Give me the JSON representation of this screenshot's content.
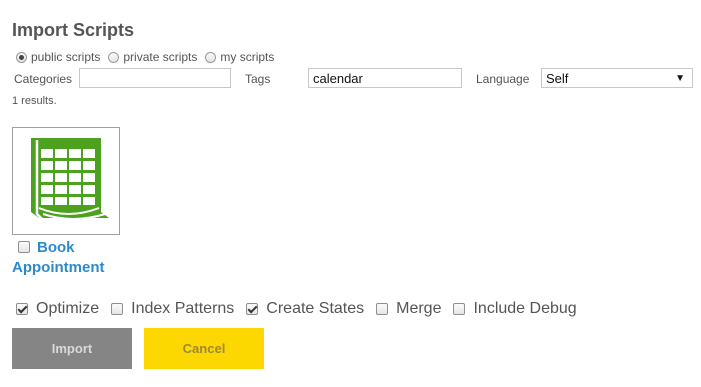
{
  "title": "Import Scripts",
  "scope": {
    "options": [
      {
        "label": "public scripts",
        "checked": true
      },
      {
        "label": "private scripts",
        "checked": false
      },
      {
        "label": "my scripts",
        "checked": false
      }
    ]
  },
  "filters": {
    "categories_label": "Categories",
    "categories_value": "",
    "tags_label": "Tags",
    "tags_value": "calendar",
    "language_label": "Language",
    "language_value": "Self",
    "language_caret": "▼"
  },
  "results_text": "1 results.",
  "results": [
    {
      "line1": "Book",
      "line2": "Appointment",
      "icon": "calendar-icon",
      "icon_color": "#4ca11f",
      "selected": false
    }
  ],
  "options": {
    "optimize": {
      "label": "Optimize",
      "checked": true
    },
    "index_patterns": {
      "label": "Index Patterns",
      "checked": false
    },
    "create_states": {
      "label": "Create States",
      "checked": true
    },
    "merge": {
      "label": "Merge",
      "checked": false
    },
    "include_debug": {
      "label": "Include Debug",
      "checked": false
    }
  },
  "buttons": {
    "import": "Import",
    "cancel": "Cancel"
  },
  "colors": {
    "link": "#2d8ac8",
    "import_bg": "#858585",
    "cancel_bg": "#fdd700"
  }
}
